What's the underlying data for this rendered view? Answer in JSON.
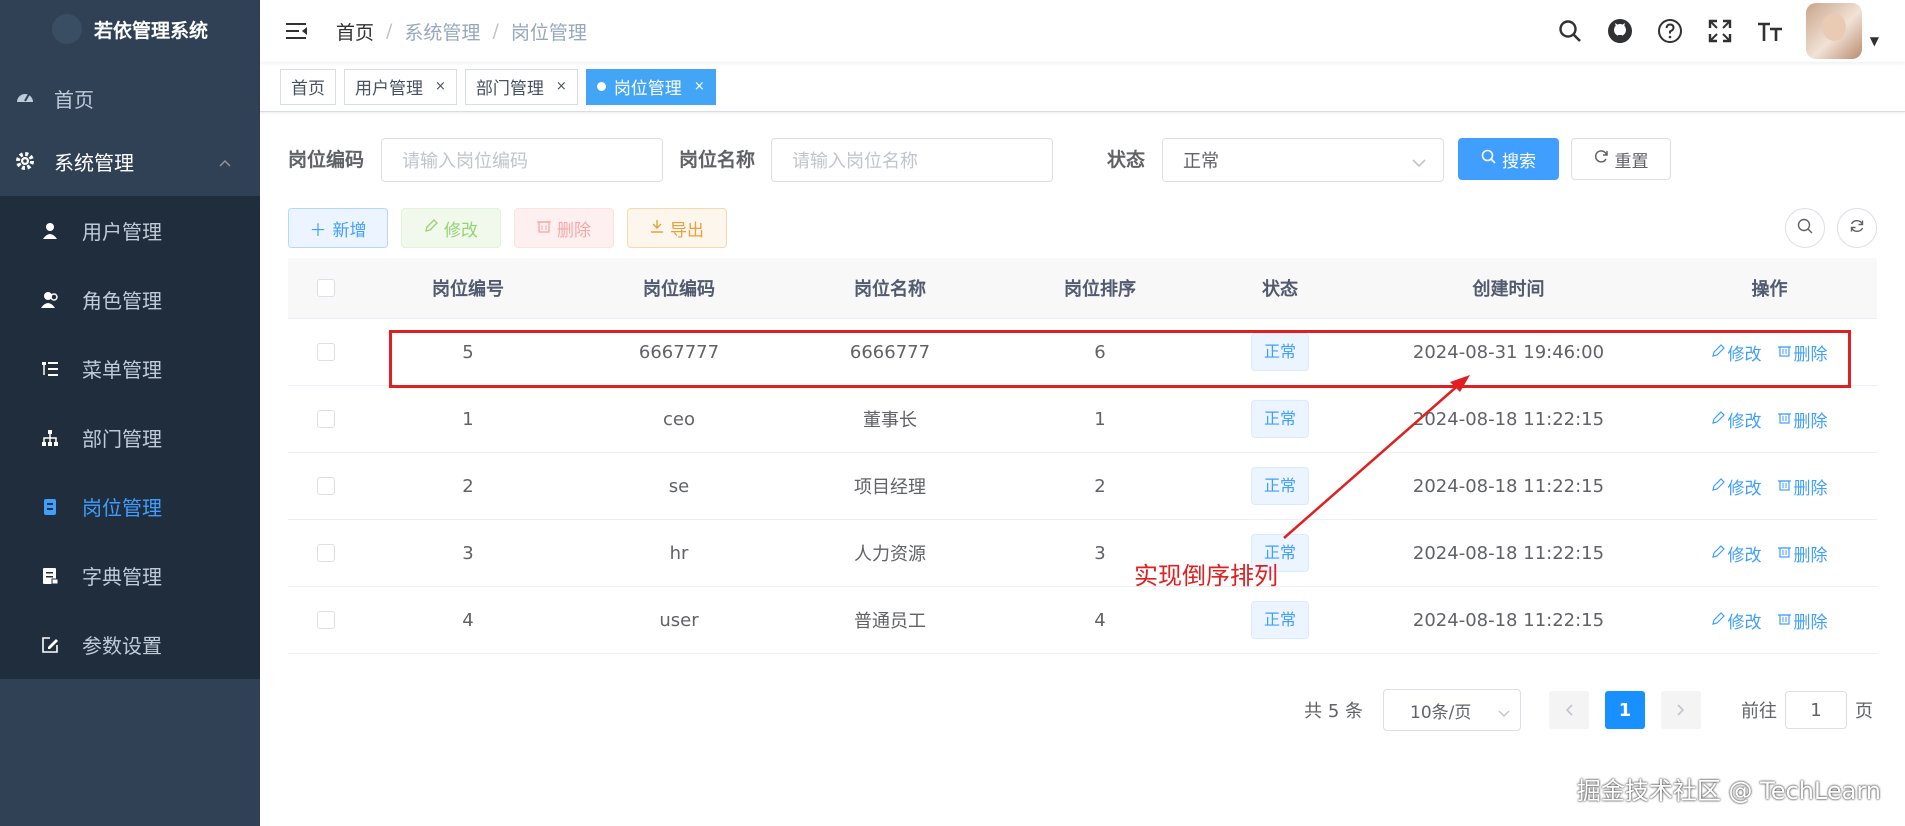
{
  "app": {
    "title": "若依管理系统"
  },
  "sidebar": {
    "items": [
      {
        "label": "首页",
        "icon": "dashboard-icon"
      },
      {
        "label": "系统管理",
        "icon": "gear-icon"
      }
    ],
    "sub_items": [
      {
        "label": "用户管理",
        "icon": "user-icon"
      },
      {
        "label": "角色管理",
        "icon": "peoples-icon"
      },
      {
        "label": "菜单管理",
        "icon": "tree-table-icon"
      },
      {
        "label": "部门管理",
        "icon": "tree-icon"
      },
      {
        "label": "岗位管理",
        "icon": "post-icon",
        "active": true
      },
      {
        "label": "字典管理",
        "icon": "dict-icon"
      },
      {
        "label": "参数设置",
        "icon": "edit-icon"
      }
    ]
  },
  "breadcrumb": [
    "首页",
    "系统管理",
    "岗位管理"
  ],
  "tags": [
    "首页",
    "用户管理",
    "部门管理",
    "岗位管理"
  ],
  "search": {
    "code_label": "岗位编码",
    "code_placeholder": "请输入岗位编码",
    "name_label": "岗位名称",
    "name_placeholder": "请输入岗位名称",
    "status_label": "状态",
    "status_value": "正常",
    "search_button": "搜索",
    "reset_button": "重置"
  },
  "toolbar": {
    "add": "新增",
    "edit": "修改",
    "delete": "删除",
    "export": "导出"
  },
  "table": {
    "columns": [
      "岗位编号",
      "岗位编码",
      "岗位名称",
      "岗位排序",
      "状态",
      "创建时间",
      "操作"
    ],
    "rows": [
      {
        "id": "5",
        "code": "6667777",
        "name": "6666777",
        "sort": "6",
        "status": "正常",
        "created": "2024-08-31 19:46:00"
      },
      {
        "id": "1",
        "code": "ceo",
        "name": "董事长",
        "sort": "1",
        "status": "正常",
        "created": "2024-08-18 11:22:15"
      },
      {
        "id": "2",
        "code": "se",
        "name": "项目经理",
        "sort": "2",
        "status": "正常",
        "created": "2024-08-18 11:22:15"
      },
      {
        "id": "3",
        "code": "hr",
        "name": "人力资源",
        "sort": "3",
        "status": "正常",
        "created": "2024-08-18 11:22:15"
      },
      {
        "id": "4",
        "code": "user",
        "name": "普通员工",
        "sort": "4",
        "status": "正常",
        "created": "2024-08-18 11:22:15"
      }
    ],
    "op_edit": "修改",
    "op_delete": "删除"
  },
  "pagination": {
    "total_text": "共 5 条",
    "page_size": "10条/页",
    "current_page": "1",
    "goto_prefix": "前往",
    "goto_value": "1",
    "goto_suffix": "页"
  },
  "annotation": {
    "text": "实现倒序排列"
  },
  "watermark": "掘金技术社区 @ TechLearn",
  "colors": {
    "sidebar_bg": "#304156",
    "submenu_bg": "#1f2d3d",
    "primary": "#409eff",
    "annotation": "#e02020"
  }
}
